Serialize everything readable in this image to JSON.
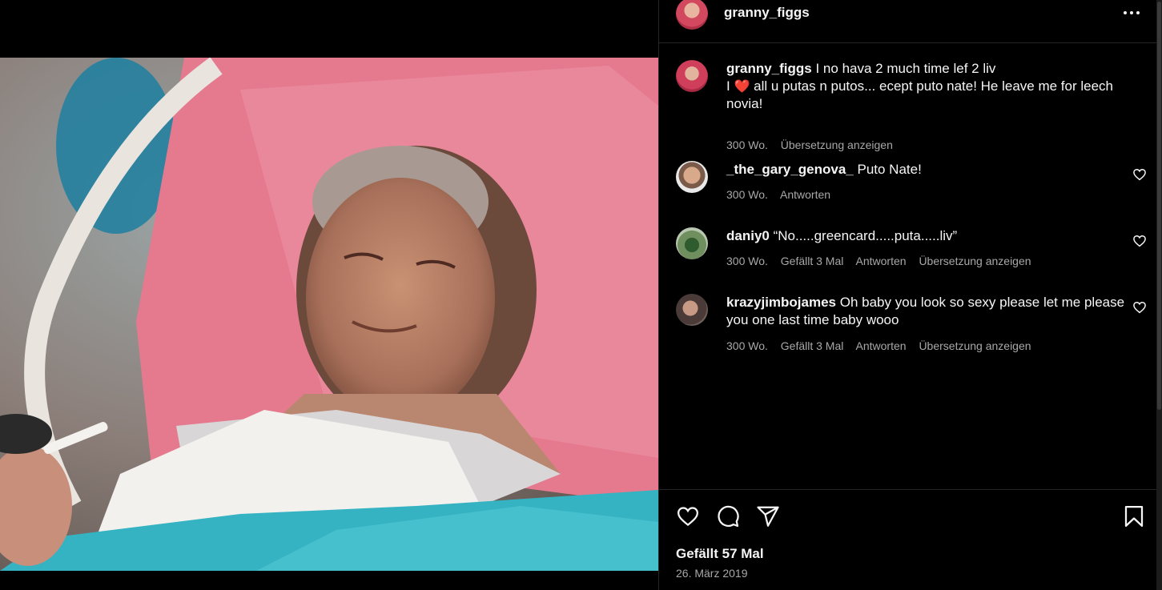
{
  "post": {
    "author": "granny_figgs",
    "caption_line1": "I no hava 2 much time lef 2 liv",
    "caption_line2_pre": "I",
    "caption_heart": "❤️",
    "caption_line2_post": "all u putas n putos... ecept puto nate! He leave me for leech novia!",
    "caption_age": "300 Wo.",
    "caption_translate": "Übersetzung anzeigen"
  },
  "comments": [
    {
      "user": "_the_gary_genova_",
      "text": "Puto Nate!",
      "age": "300 Wo.",
      "reply": "Antworten"
    },
    {
      "user": "daniy0",
      "text": "“No.....greencard.....puta.....liv”",
      "age": "300 Wo.",
      "likes": "Gefällt 3 Mal",
      "reply": "Antworten",
      "translate": "Übersetzung anzeigen"
    },
    {
      "user": "krazyjimbojames",
      "text": "Oh baby you look so sexy please let me please you one last time baby wooo",
      "age": "300 Wo.",
      "likes": "Gefällt 3 Mal",
      "reply": "Antworten",
      "translate": "Übersetzung anzeigen"
    }
  ],
  "footer": {
    "likes": "Gefällt 57 Mal",
    "date": "26. März 2019"
  },
  "icons": [
    "more-options-icon",
    "heart-icon",
    "comment-icon",
    "share-icon",
    "bookmark-icon"
  ],
  "colors": {
    "heart": "#ed4956",
    "muted_text": "#a8a8a8",
    "divider": "#262626"
  }
}
